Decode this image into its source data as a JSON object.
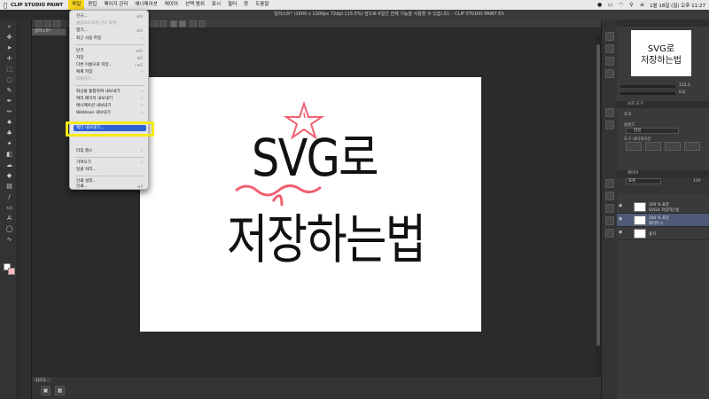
{
  "menubar": {
    "app_name": "CLIP STUDIO PAINT",
    "items": [
      "파일",
      "편집",
      "페이지 관리",
      "애니메이션",
      "레이어",
      "선택 범위",
      "표시",
      "필터",
      "창",
      "도움말"
    ],
    "datetime": "1월 18일 (일) 오후 11:27"
  },
  "window": {
    "title": "일러스트* (1600 x 1200px 72dpi 115.5%)  앞으로 6일간 전체 기능을 사용할 수 있습니다. - CLIP STUDIO PAINT EX"
  },
  "tab": {
    "label": "일러스트*"
  },
  "file_menu": {
    "items": [
      {
        "label": "신규...",
        "shortcut": "⌘N"
      },
      {
        "label": "클립보드에서 신규 작성",
        "disabled": true
      },
      {
        "label": "열기...",
        "shortcut": "⌘O"
      },
      {
        "label": "최근 사용 파일",
        "submenu": true
      },
      {
        "label": "닫기",
        "shortcut": "⌘W"
      },
      {
        "label": "저장",
        "shortcut": "⌘S"
      },
      {
        "label": "다른 이름으로 저장...",
        "shortcut": "⇧⌘S"
      },
      {
        "label": "복제 저장",
        "submenu": true
      },
      {
        "label": "되돌리기...",
        "disabled": true
      },
      {
        "label": "화상을 통합하여 내보내기",
        "submenu": true
      },
      {
        "label": "여러 페이지 내보내기",
        "submenu": true
      },
      {
        "label": "애니메이션 내보내기",
        "submenu": true
      },
      {
        "label": "Webtoon 내보내기",
        "submenu": true
      },
      {
        "label": "벡터 내보내기..."
      },
      {
        "label": "타임 랩스",
        "submenu": true
      },
      {
        "label": "가져오기",
        "submenu": true
      },
      {
        "label": "일괄 처리..."
      },
      {
        "label": "인쇄 설정..."
      },
      {
        "label": "인쇄...",
        "shortcut": "⌘P"
      }
    ]
  },
  "canvas": {
    "line1": "SVG로",
    "line2": "저장하는법",
    "zoom": "115.5"
  },
  "navigator": {
    "line1": "SVG로",
    "line2": "저장하는법",
    "zoom_value": "115.5",
    "angle_value": "0.0"
  },
  "tool_property": {
    "tab_label": "보조 도구",
    "section1": "효과",
    "section2": "블렌드",
    "blend_value": "합성",
    "section3": "도구 내비게이션"
  },
  "layers": {
    "panel_label": "레이어",
    "blend_mode": "표준",
    "opacity": "100",
    "rows": [
      {
        "name_line1": "100 % 표준",
        "name_line2": "SVG로 저장하는법",
        "selected": false
      },
      {
        "name_line1": "100 % 표준",
        "name_line2": "레이어 2",
        "selected": true
      },
      {
        "name_line1": "용지",
        "name_line2": "",
        "selected": false
      }
    ]
  },
  "colors": {
    "highlight": "#2f63d3",
    "callout": "#f4ea16",
    "doodle": "#f06070",
    "menu_active": "#f7d51e"
  }
}
